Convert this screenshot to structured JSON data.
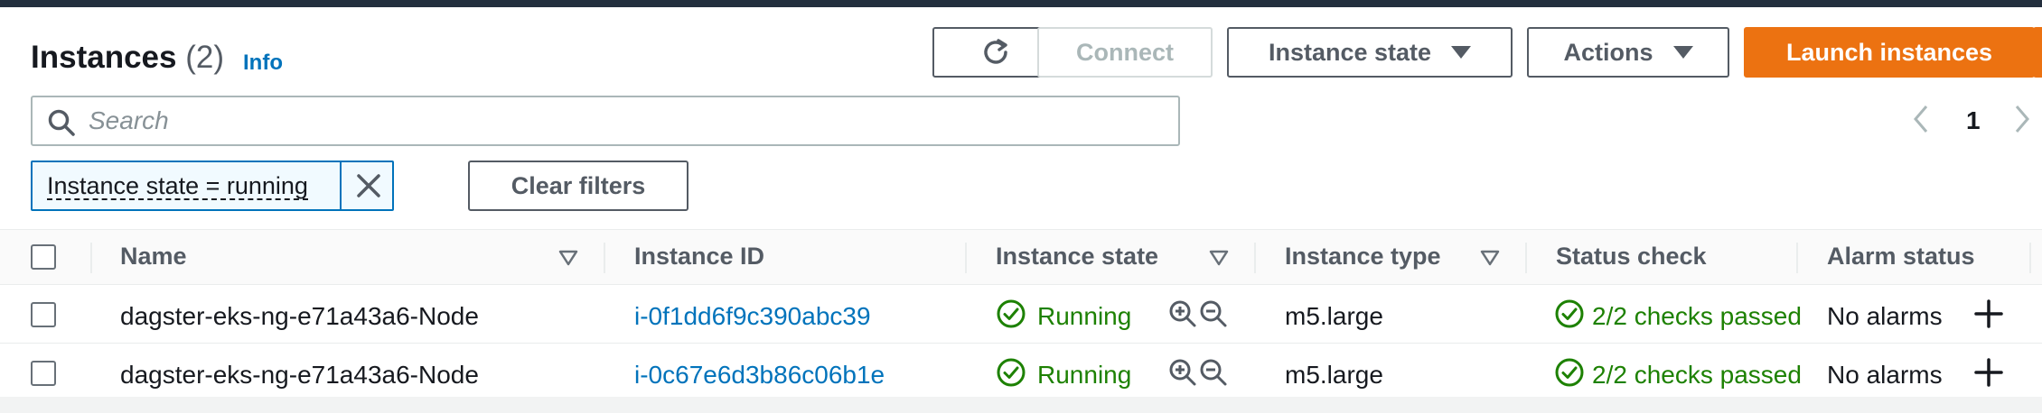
{
  "header": {
    "title": "Instances",
    "count": "(2)",
    "info_label": "Info"
  },
  "toolbar": {
    "refresh_icon": "refresh-icon",
    "connect_label": "Connect",
    "instance_state_label": "Instance state",
    "actions_label": "Actions",
    "launch_label": "Launch instances"
  },
  "search": {
    "placeholder": "Search",
    "value": ""
  },
  "pagination": {
    "current_page": "1"
  },
  "filters": {
    "token_label": "Instance state = running",
    "clear_label": "Clear filters"
  },
  "table": {
    "columns": [
      "Name",
      "Instance ID",
      "Instance state",
      "Instance type",
      "Status check",
      "Alarm status"
    ],
    "rows": [
      {
        "name": "dagster-eks-ng-e71a43a6-Node",
        "instance_id": "i-0f1dd6f9c390abc39",
        "state": "Running",
        "type": "m5.large",
        "status_check": "2/2 checks passed",
        "alarm": "No alarms"
      },
      {
        "name": "dagster-eks-ng-e71a43a6-Node",
        "instance_id": "i-0c67e6d3b86c06b1e",
        "state": "Running",
        "type": "m5.large",
        "status_check": "2/2 checks passed",
        "alarm": "No alarms"
      }
    ]
  },
  "colors": {
    "primary": "#ec7211",
    "link": "#0073bb",
    "success": "#1d8102",
    "topbar": "#232f3e"
  }
}
